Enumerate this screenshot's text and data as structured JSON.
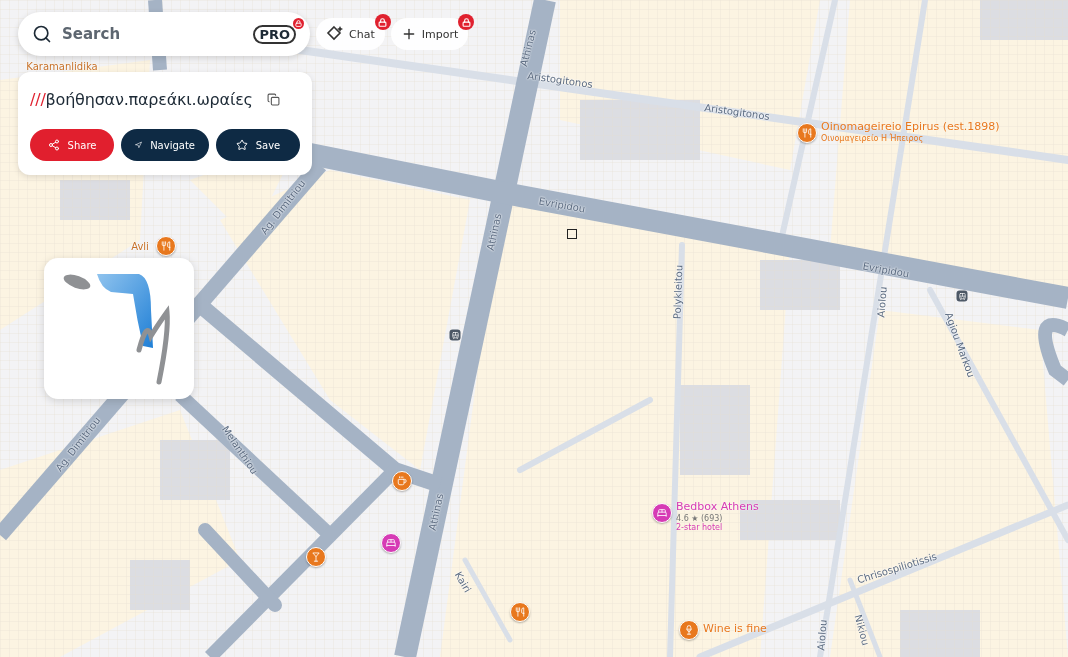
{
  "search": {
    "placeholder": "Search",
    "badge": "PRO",
    "locked": true
  },
  "top_buttons": [
    {
      "kind": "chat",
      "label": "Chat",
      "locked": true
    },
    {
      "kind": "import",
      "label": "Import",
      "locked": true
    }
  ],
  "location": {
    "prefix": "///",
    "words": "βοήθησαν.παρεάκι.ωραίες"
  },
  "actions": [
    {
      "kind": "share",
      "label": "Share"
    },
    {
      "kind": "navigate",
      "label": "Navigate"
    },
    {
      "kind": "save",
      "label": "Save"
    }
  ],
  "map": {
    "street_labels": [
      "Karamanlidika",
      "Aristogitonos",
      "Aristogitonos",
      "Athinas",
      "Evripidou",
      "Evripidou",
      "Athinas",
      "Athinas",
      "Ag. Dimitriou",
      "Ag. Dimitriou",
      "Melanthiou",
      "Polykleitou",
      "Aiolou",
      "Agiou Markou",
      "Chrisospiliotissis",
      "Kairi",
      "Aiolou",
      "Nikiou",
      "Avli"
    ],
    "places": [
      {
        "kind": "restaurant",
        "color": "#e8781e",
        "name": "Oinomageireio Epirus (est.1898)",
        "subtitle": "Οινομαγειρείο Η Ήπειρος"
      },
      {
        "kind": "hotel",
        "color": "#d63bb5",
        "name": "Bedbox Athens",
        "rating": "4.6 ★ (693)",
        "subtitle": "2-star hotel"
      },
      {
        "kind": "wine",
        "color": "#e8781e",
        "name": "Wine is fine"
      },
      {
        "kind": "cafe",
        "color": "#e8781e"
      },
      {
        "kind": "hotel",
        "color": "#d63bb5"
      },
      {
        "kind": "cocktail",
        "color": "#e8781e"
      },
      {
        "kind": "restaurant",
        "color": "#e8781e"
      },
      {
        "kind": "restaurant",
        "color": "#e8781e"
      }
    ]
  }
}
